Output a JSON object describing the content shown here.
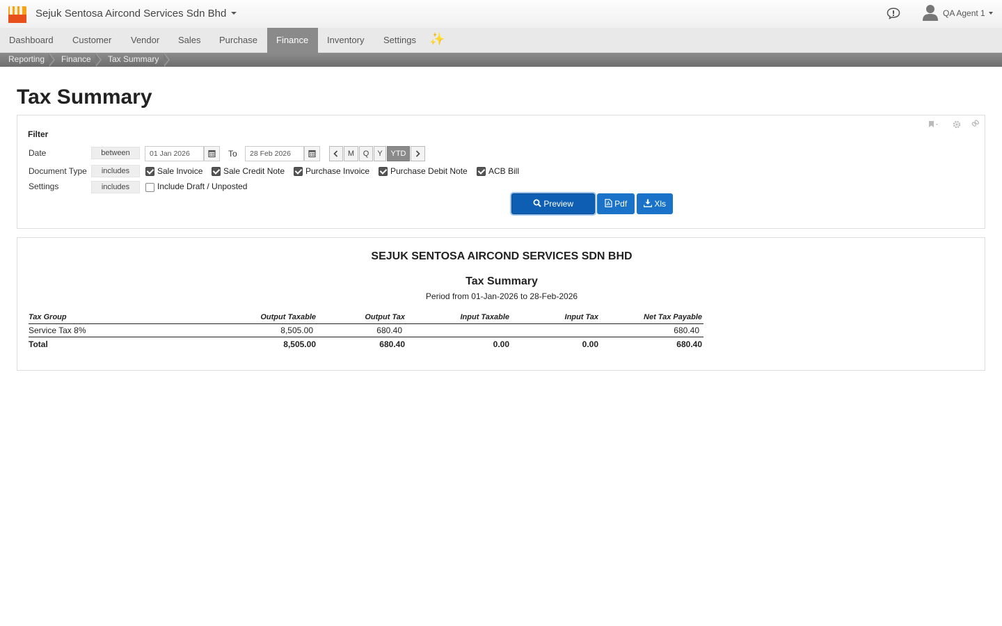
{
  "header": {
    "company": "Sejuk Sentosa Aircond Services Sdn Bhd",
    "user": "QA Agent 1"
  },
  "nav": {
    "items": [
      "Dashboard",
      "Customer",
      "Vendor",
      "Sales",
      "Purchase",
      "Finance",
      "Inventory",
      "Settings"
    ],
    "active": "Finance"
  },
  "breadcrumb": [
    "Reporting",
    "Finance",
    "Tax Summary"
  ],
  "page_title": "Tax Summary",
  "filter": {
    "title": "Filter",
    "date": {
      "label": "Date",
      "operator": "between",
      "from": "01 Jan 2026",
      "to_label": "To",
      "to": "28 Feb 2026",
      "periods": [
        "M",
        "Q",
        "Y",
        "YTD"
      ],
      "active_period": "YTD"
    },
    "document_type": {
      "label": "Document Type",
      "operator": "includes",
      "options": [
        {
          "label": "Sale Invoice",
          "checked": true
        },
        {
          "label": "Sale Credit Note",
          "checked": true
        },
        {
          "label": "Purchase Invoice",
          "checked": true
        },
        {
          "label": "Purchase Debit Note",
          "checked": true
        },
        {
          "label": "ACB Bill",
          "checked": true
        }
      ]
    },
    "settings": {
      "label": "Settings",
      "operator": "includes",
      "options": [
        {
          "label": "Include Draft / Unposted",
          "checked": false
        }
      ]
    },
    "buttons": {
      "preview": "Preview",
      "pdf": "Pdf",
      "xls": "Xls"
    }
  },
  "report": {
    "company": "SEJUK SENTOSA AIRCOND SERVICES SDN BHD",
    "title": "Tax Summary",
    "period": "Period from 01-Jan-2026 to 28-Feb-2026",
    "columns": [
      "Tax Group",
      "Output Taxable",
      "Output Tax",
      "Input Taxable",
      "Input Tax",
      "Net Tax Payable"
    ],
    "rows": [
      {
        "tax_group": "Service Tax 8%",
        "output_taxable": "8,505.00",
        "output_tax": "680.40",
        "input_taxable": "",
        "input_tax": "",
        "net_tax_payable": "680.40"
      }
    ],
    "total": {
      "label": "Total",
      "output_taxable": "8,505.00",
      "output_tax": "680.40",
      "input_taxable": "0.00",
      "input_tax": "0.00",
      "net_tax_payable": "680.40"
    }
  }
}
